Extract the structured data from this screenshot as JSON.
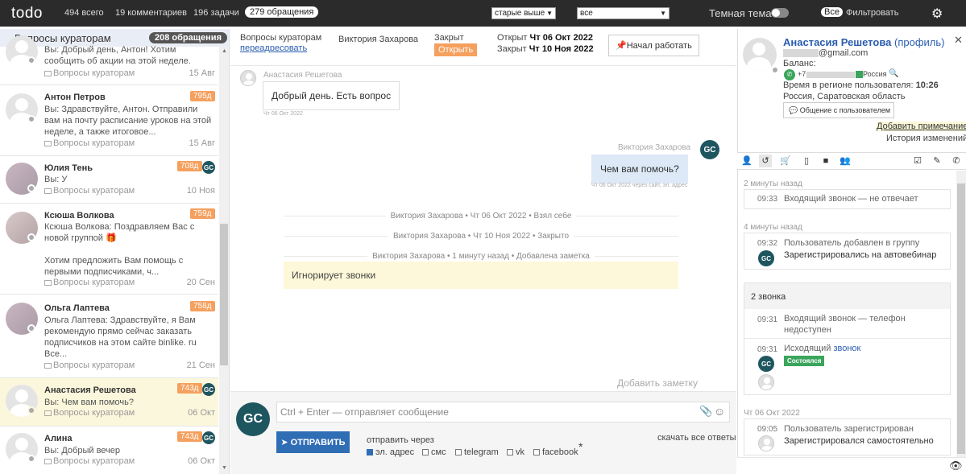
{
  "topbar": {
    "logo": "todo",
    "total": "494 всего",
    "comments": "19 комментариев",
    "tasks": "196 задачи",
    "requests": "279 обращения",
    "sort_select": "старые выше",
    "filter_select": "все",
    "dark_theme": "Темная тема",
    "all_badge": "Все",
    "filter_label": "Фильтровать"
  },
  "sidebar": {
    "title": "Вопросы кураторам",
    "count": "208 обращения",
    "items": [
      {
        "name": "",
        "msg": "Вы: Добрый день, Антон! Хотим сообщить об акции на этой неделе.",
        "queue": "Вопросы кураторам",
        "date": "15 Авг",
        "tag": ""
      },
      {
        "name": "Антон Петров",
        "msg": "Вы: Здравствуйте, Антон. Отправили вам на почту расписание уроков на этой неделе, а также итоговое...",
        "queue": "Вопросы кураторам",
        "date": "15 Авг",
        "tag": "795д"
      },
      {
        "name": "Юлия Тень",
        "msg": "Вы: У",
        "queue": "Вопросы кураторам",
        "date": "10 Ноя",
        "tag": "708д"
      },
      {
        "name": "Ксюша Волкова",
        "msg": "Ксюша Волкова: Поздравляем Вас с новой группой 🎁",
        "msg2": "Хотим предложить Вам помощь с первыми подписчиками, ч...",
        "queue": "Вопросы кураторам",
        "date": "20 Сен",
        "tag": "759д"
      },
      {
        "name": "Ольга Лаптева",
        "msg": "Ольга Лаптева: Здравствуйте, я Вам рекомендую прямо сейчас заказать подписчиков на этом сайте binlike. ru Все...",
        "queue": "Вопросы кураторам",
        "date": "21 Сен",
        "tag": "758д"
      },
      {
        "name": "Анастасия Решетова",
        "msg": "Вы: Чем вам помочь?",
        "queue": "Вопросы кураторам",
        "date": "06 Окт",
        "tag": "743д"
      },
      {
        "name": "Алина",
        "msg": "Вы: Добрый вечер",
        "queue": "Вопросы кураторам",
        "date": "06 Окт",
        "tag": "743д"
      }
    ]
  },
  "ticket": {
    "queue": "Вопросы кураторам",
    "reassign": "переадресовать",
    "agent": "Виктория Захарова",
    "status_label": "Закрыт",
    "open_button": "Открыть",
    "opened_label": "Открыт",
    "opened_date": "Чт 06 Окт 2022",
    "closed_label": "Закрыт",
    "closed_date": "Чт 10 Ноя 2022",
    "start_button": "Начал работать"
  },
  "messages": {
    "m1_name": "Анастасия Решетова",
    "m1_text": "Добрый день. Есть вопрос",
    "m1_time": "Чт 06 Окт 2022",
    "m2_name": "Виктория Захарова",
    "m2_text": "Чем вам помочь?",
    "m2_time": "Чт 06 Окт 2022 через сайт, эл. адрес",
    "ev1": "Виктория Захарова • Чт 06 Окт 2022 • Взял себе",
    "ev2": "Виктория Захарова • Чт 10 Ноя 2022 • Закрыто",
    "ev3": "Виктория Захарова • 1 минуту назад • Добавлена заметка",
    "note": "Игнорирует звонки",
    "add_note": "Добавить заметку"
  },
  "compose": {
    "placeholder": "Ctrl + Enter — отправляет сообщение",
    "send": "ОТПРАВИТЬ",
    "send_via": "отправить через",
    "download": "скачать все ответы",
    "ch_email": "эл. адрес",
    "ch_sms": "смс",
    "ch_tg": "telegram",
    "ch_vk": "vk",
    "ch_fb": "facebook",
    "asterisk": "*"
  },
  "user": {
    "name": "Анастасия Решетова",
    "profile": "(профиль)",
    "email": "@gmail.com",
    "balance": "Баланс:",
    "phone_prefix": "+7",
    "country": "Россия",
    "region_time_label": "Время в регионе пользователя:",
    "region_time": "10:26",
    "region": "Россия, Саратовская область",
    "chat_btn": "Общение с пользователем",
    "add_note": "Добавить примечание",
    "history": "История изменений"
  },
  "timeline": {
    "g1": "2 минуты назад",
    "e1_time": "09:33",
    "e1_text": "Входящий звонок — не отвечает",
    "g2": "4 минуты назад",
    "e2_time": "09:32",
    "e2_text": "Пользователь добавлен в группу",
    "e2_sub": "Зарегистрировались на автовебинар",
    "calls_title": "2 звонка",
    "c1_time": "09:31",
    "c1_text": "Входящий звонок — телефон",
    "c1_text2": "недоступен",
    "c2_time": "09:31",
    "c2_text": "Исходящий",
    "c2_link": "звонок",
    "c2_badge": "Состоялся",
    "g3": "Чт 06 Окт 2022",
    "e3_time": "09:05",
    "e3_text": "Пользователь зарегистрирован",
    "e3_sub": "Зарегистрировался самостоятельно"
  },
  "icons": [
    "gear-icon",
    "person-icon",
    "history-icon",
    "cart-icon",
    "tablet-icon",
    "video-icon",
    "group-icon",
    "checkbox-icon",
    "pencil-icon",
    "phone-icon",
    "close-icon",
    "eye-icon",
    "paperclip-icon",
    "emoji-icon",
    "pin-icon",
    "chat-icon",
    "search-icon"
  ]
}
